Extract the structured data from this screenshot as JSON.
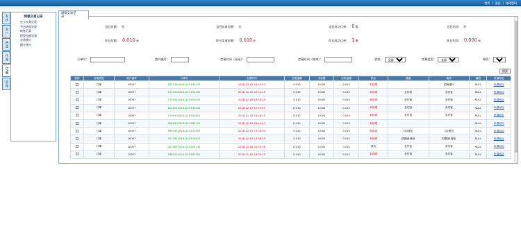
{
  "toplinks": [
    "首页",
    "退出",
    "修改密码"
  ],
  "vtabs": [
    "系统",
    "商户",
    "通道",
    "代理",
    "订单",
    "管理"
  ],
  "sidebar": {
    "title": "网银交易记录",
    "items": [
      "在卡交易记录",
      "平台转账记录",
      "转账记录",
      "提现金额记录",
      "交易统计",
      "额交统计"
    ]
  },
  "tab": "网银交易记\n录",
  "stats": {
    "row1": [
      {
        "label": "当日总额：",
        "value": "元"
      },
      {
        "label": "当日实收金额：",
        "value": "元"
      },
      {
        "label": "当日成功订单：",
        "big": "0",
        "unit": "笔"
      },
      {
        "label": "当日利润：",
        "value": "元"
      }
    ],
    "row2": [
      {
        "label": "昨日总额：",
        "big": "0.010",
        "unit": "元"
      },
      {
        "label": "昨日实收金额：",
        "big": "0.010",
        "unit": "元"
      },
      {
        "label": "昨日成功订单：",
        "big": "1",
        "unit": "笔"
      },
      {
        "label": "昨日利润：",
        "big": "0.000",
        "unit": "元"
      }
    ]
  },
  "filters": {
    "order_label": "订单号：",
    "merchant_label": "商户编号：",
    "time_start_label": "交易时间（开始）：",
    "time_end_label": "交易时间（结束）：",
    "status_label": "状态：",
    "status_value": "全部",
    "type_label": "交易类型：",
    "type_value": "全部",
    "per_page_label": "每页：",
    "per_page_value": "10条",
    "search_button": "搜索"
  },
  "table": {
    "headers": [
      "选择",
      "交易类型",
      "商户编号",
      "订单号",
      "交易时间",
      "交易金额",
      "手续费",
      "实际金额",
      "状态",
      "通道",
      "操作",
      "通知",
      "来源地址"
    ],
    "rows": [
      [
        "订单",
        "10097",
        "78211620181219195433",
        "2018-12-19 19:54:53",
        "0.010",
        "0.000",
        "0.010",
        "未处理",
        "",
        "招商银行",
        "NULL",
        "来源地址"
      ],
      [
        "订单",
        "10097",
        "44931020181219195439",
        "2018-12-19 19:54:29",
        "0.010",
        "0.000",
        "0.010",
        "未处理",
        "支付宝",
        "支付宝",
        "NULL",
        "来源地址"
      ],
      [
        "订单",
        "10097",
        "73315420181219195005",
        "2018-12-19 19:50:25",
        "0.010",
        "0.000",
        "0.010",
        "未处理",
        "支付宝",
        "支付宝",
        "NULL",
        "来源地址"
      ],
      [
        "订单",
        "10097",
        "62542520181219194942",
        "2018-12-19 19:49:47",
        "0.010",
        "0.000",
        "0.010",
        "未处理",
        "支付宝",
        "支付宝",
        "NULL",
        "来源地址"
      ],
      [
        "订单",
        "10097",
        "13994020181219194815",
        "2018-12-19 19:48:25",
        "0.010",
        "0.000",
        "0.010",
        "未处理",
        "支付宝",
        "支付宝",
        "NULL",
        "来源地址"
      ],
      [
        "订单",
        "10097",
        "78859020181219182142",
        "2018-12-19 18:21:47",
        "0.010",
        "0.000",
        "0.010",
        "未处理",
        "",
        "",
        "NULL",
        "来源地址"
      ],
      [
        "订单",
        "10097",
        "96904520181219133903",
        "2018-12-19 13:39:09",
        "0.010",
        "0.000",
        "0.010",
        "未处理",
        "QQ钱包",
        "QQ钱包",
        "NULL",
        "来源地址"
      ],
      [
        "订单",
        "10097",
        "30779120181219135823",
        "2018-12-19 13:58:29",
        "0.010",
        "0.000",
        "0.010",
        "未处理",
        "财富通-微信",
        "财富通-微信",
        "NULL",
        "来源地址"
      ],
      [
        "订单",
        "10097",
        "22100920181219205330",
        "2018-12-18 20:53:36",
        "0.010",
        "0.000",
        "0.010",
        "成功",
        "支付宝",
        "支付宝",
        "NULL",
        "来源地址"
      ],
      [
        "订单",
        "10097",
        "59805020181218163900",
        "2018-12-18 16:39:22",
        "0.010",
        "0.000",
        "0.010",
        "未处理",
        "支付宝",
        "支付宝",
        "NULL",
        "来源地址"
      ]
    ]
  },
  "colors": {
    "header_bar": "#1b5fa0",
    "table_header": "#4978a7",
    "accent_red": "#e0001c",
    "link_blue": "#1b4fa8"
  }
}
